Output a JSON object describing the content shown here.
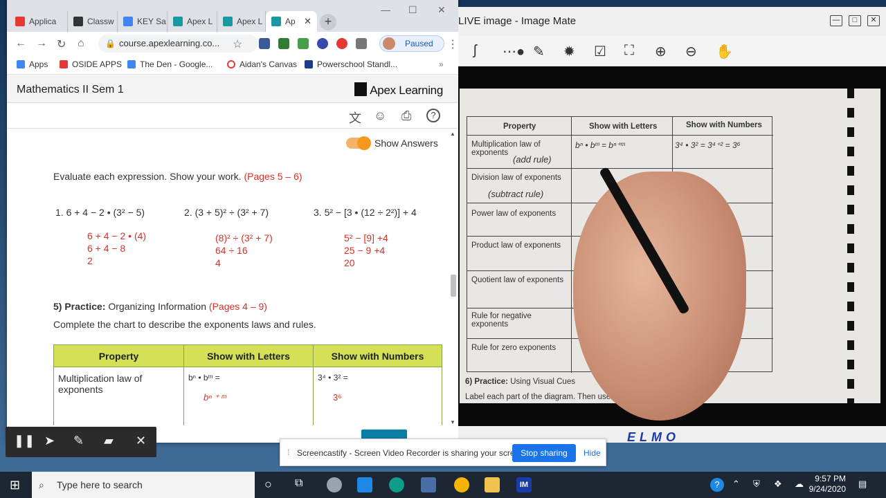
{
  "browser": {
    "tabs": [
      {
        "label": "Applica",
        "color": "#e53935"
      },
      {
        "label": "Classw",
        "color": "#333333"
      },
      {
        "label": "KEY Sa",
        "color": "#4285f4"
      },
      {
        "label": "Apex L",
        "color": "#1a9aa0"
      },
      {
        "label": "Apex L",
        "color": "#1a9aa0"
      },
      {
        "label": "Ap",
        "color": "#1a9aa0"
      }
    ],
    "url": "course.apexlearning.co...",
    "profile_status": "Paused",
    "bookmarks": [
      "Apps",
      "OSIDE APPS",
      "The Den - Google...",
      "Aidan's Canvas",
      "Powerschool Standl..."
    ]
  },
  "apex": {
    "course_title": "Mathematics II Sem 1",
    "logo": "Apex Learning",
    "toggle_label": "Show Answers",
    "instructions": "Evaluate each expression. Show your work.",
    "instructions_pages": "(Pages 5 – 6)",
    "problems": [
      {
        "text": "1. 6 + 4 − 2 • (3² − 5)",
        "work": [
          "6 + 4 − 2 • (4)",
          "6 + 4 − 8",
          "2"
        ]
      },
      {
        "text": "2. (3 + 5)² ÷ (3² + 7)",
        "work": [
          "(8)² ÷ (3² + 7)",
          "64 ÷ 16",
          "4"
        ]
      },
      {
        "text": "3. 5² − [3 • (12 ÷ 2²)] + 4",
        "work": [
          "5² − [9] +4",
          "25 − 9 +4",
          "20"
        ]
      }
    ],
    "practice_label": "5) Practice:",
    "practice_title": "Organizing Information",
    "practice_pages": "(Pages 4 – 9)",
    "practice_instructions": "Complete the chart to describe the exponents laws and rules.",
    "table": {
      "headers": [
        "Property",
        "Show with Letters",
        "Show with Numbers"
      ],
      "row": {
        "property": "Multiplication law of exponents",
        "letters": "bⁿ • bᵐ =",
        "letters_answer": "bⁿ ⁺ ᵐ",
        "numbers": "3⁴ • 3² =",
        "numbers_answer": "3⁶"
      }
    }
  },
  "screencastify": {
    "message": "Screencastify - Screen Video Recorder is sharing your screen.",
    "stop_label": "Stop sharing",
    "hide_label": "Hide"
  },
  "imagemate": {
    "title": "LIVE image - Image Mate",
    "brand": "ELMO",
    "paper_headers": [
      "Property",
      "Show with Letters",
      "Show with Numbers"
    ],
    "paper_rows": [
      "Multiplication law of exponents",
      "Division law of exponents",
      "Power law of exponents",
      "Product law of exponents",
      "Quotient law of exponents",
      "Rule for negative exponents",
      "Rule for zero exponents"
    ],
    "handwriting": [
      "(add rule)",
      "(subtract rule)",
      "bⁿ • bᵐ = bⁿ⁺ᵐ",
      "3⁴ • 3² = 3⁴⁺² = 3⁶"
    ],
    "footer_label": "6) Practice:",
    "footer_title": "Using Visual Cues",
    "footer_text": "Label each part of the diagram. Then use yo"
  },
  "taskbar": {
    "search_placeholder": "Type here to search",
    "time": "9:57 PM",
    "date": "9/24/2020"
  }
}
